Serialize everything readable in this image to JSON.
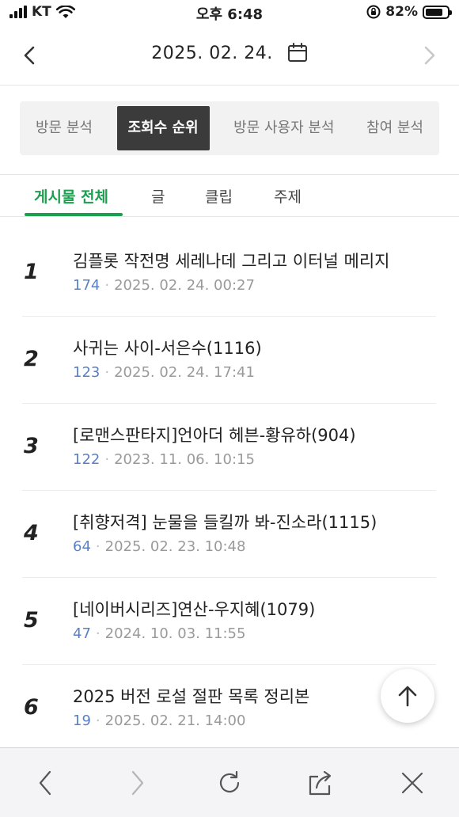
{
  "status": {
    "carrier": "KT",
    "time": "오후 6:48",
    "battery_percent": "82%",
    "battery_level": 0.82
  },
  "header": {
    "date": "2025. 02. 24.",
    "prev_icon": "chevron-left-icon",
    "next_icon": "chevron-right-icon",
    "calendar_icon": "calendar-icon"
  },
  "segments": [
    "방문 분석",
    "조회수 순위",
    "방문 사용자 분석",
    "참여 분석"
  ],
  "active_segment": "조회수 순위",
  "sub_tabs": [
    "게시물 전체",
    "글",
    "클립",
    "주제"
  ],
  "active_sub_tab": "게시물 전체",
  "items": [
    {
      "rank": "1",
      "title": "김플롯 작전명 세레나데 그리고 이터널 메리지",
      "views": "174",
      "date": "2025. 02. 24. 00:27"
    },
    {
      "rank": "2",
      "title": "사귀는 사이-서은수(1116)",
      "views": "123",
      "date": "2025. 02. 24. 17:41"
    },
    {
      "rank": "3",
      "title": "[로맨스판타지]언아더 헤븐-황유하(904)",
      "views": "122",
      "date": "2023. 11. 06. 10:15"
    },
    {
      "rank": "4",
      "title": "[취향저격] 눈물을 들킬까 봐-진소라(1115)",
      "views": "64",
      "date": "2025. 02. 23. 10:48"
    },
    {
      "rank": "5",
      "title": "[네이버시리즈]연산-우지혜(1079)",
      "views": "47",
      "date": "2024. 10. 03. 11:55"
    },
    {
      "rank": "6",
      "title": "2025 버전 로설 절판 목록 정리본",
      "views": "19",
      "date": "2025. 02. 21. 14:00"
    }
  ],
  "fab_icon": "arrow-up-icon",
  "browser_bar": [
    "back-icon",
    "forward-icon",
    "reload-icon",
    "share-icon",
    "close-icon"
  ],
  "colors": {
    "accent": "#1aa04f",
    "views": "#5b7fc6",
    "active_segment_bg": "#3b3b3b"
  }
}
